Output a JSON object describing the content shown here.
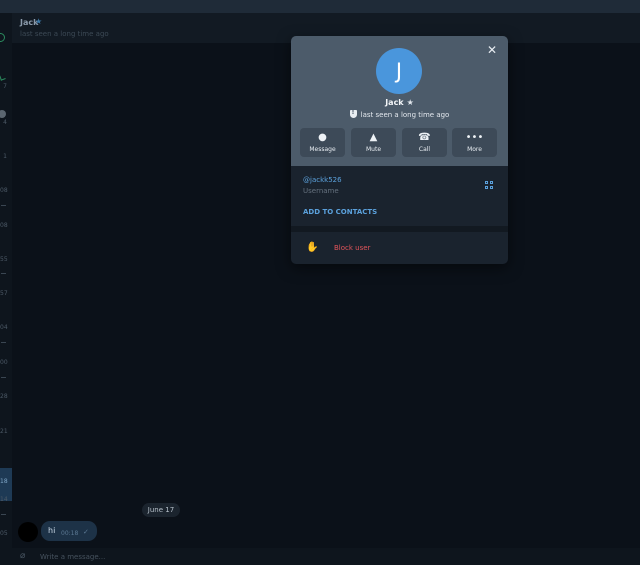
{
  "chat": {
    "title": "Jack",
    "status": "last seen a long time ago",
    "date_label": "June 17",
    "message": {
      "text": "hi",
      "time": "00:18"
    },
    "composer_placeholder": "Write a message..."
  },
  "left_strip": {
    "labels": [
      "7",
      "4",
      "1",
      "08",
      "08",
      "55",
      "57",
      "04",
      "00",
      "28",
      "21",
      "18",
      "14",
      "05"
    ]
  },
  "profile": {
    "avatar_letter": "J",
    "name": "Jack",
    "status": "last seen a long time ago",
    "actions": [
      {
        "label": "Message",
        "icon": "message-icon"
      },
      {
        "label": "Mute",
        "icon": "bell-icon"
      },
      {
        "label": "Call",
        "icon": "phone-icon"
      },
      {
        "label": "More",
        "icon": "more-icon"
      }
    ],
    "username": "@jackk526",
    "username_label": "Username",
    "add_contacts_label": "ADD TO CONTACTS",
    "block_label": "Block user"
  },
  "colors": {
    "accent": "#5ba1dc",
    "avatar": "#4a96dc",
    "danger": "#e0545a",
    "modal_header": "#4c5b6a"
  }
}
